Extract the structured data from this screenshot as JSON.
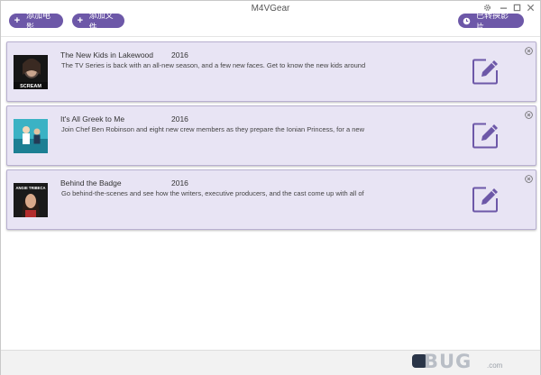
{
  "window": {
    "title": "M4VGear"
  },
  "toolbar": {
    "add_movie_label": "添加电影",
    "add_file_label": "添加文件",
    "converted_label": "已转换影片"
  },
  "items": [
    {
      "title": "The New Kids in Lakewood",
      "year": "2016",
      "description": "The TV Series is back with an all-new season, and a few new faces. Get to know the new kids around",
      "thumb_caption": "SCREAM"
    },
    {
      "title": "It's All Greek to Me",
      "year": "2016",
      "description": "Join Chef Ben Robinson and eight new crew members as they prepare the Ionian Princess, for a new",
      "thumb_caption": ""
    },
    {
      "title": "Behind the Badge",
      "year": "2016",
      "description": "Go behind-the-scenes and see how the writers, executive producers, and the cast come up with all of",
      "thumb_caption": "ANGIE TRIBECA"
    }
  ],
  "watermark": {
    "text": "BUG",
    "site": ".com"
  },
  "colors": {
    "accent": "#6d58a8",
    "card_bg": "#e8e4f4",
    "card_border": "#b8b0d0"
  }
}
